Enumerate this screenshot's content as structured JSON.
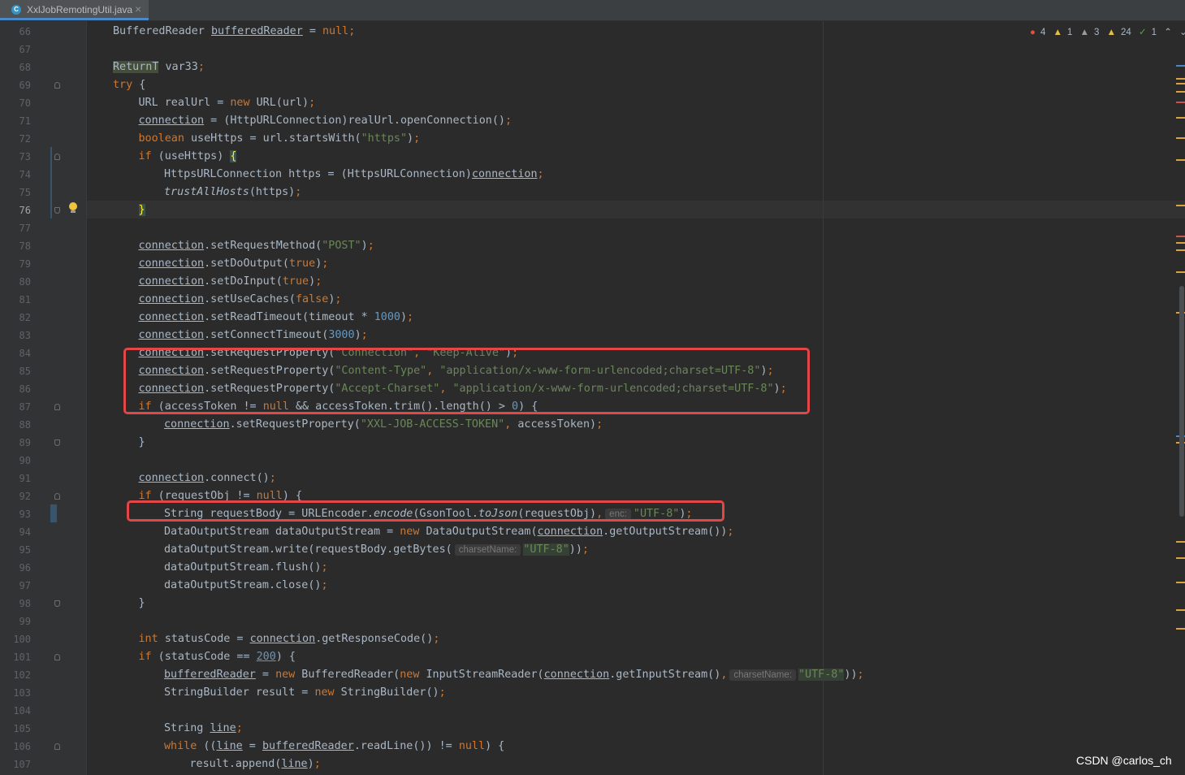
{
  "tab": {
    "icon": "class-icon",
    "label": "XxlJobRemotingUtil.java",
    "close": "×"
  },
  "inspections": {
    "errors": "4",
    "warnings": "1",
    "weak_warnings": "3",
    "typos": "24",
    "ok": "1",
    "up": "⌃",
    "down": "⌄"
  },
  "current_line": "76",
  "watermark": "CSDN @carlos_ch",
  "colors": {
    "keyword": "#cc7832",
    "string": "#6a8759",
    "number": "#6897bb",
    "highlight_box": "#e34646"
  },
  "lines": [
    {
      "n": "66",
      "indent": 0,
      "segs": [
        [
          "BufferedReader ",
          ""
        ],
        [
          "bufferedReader",
          "ul"
        ],
        [
          " = ",
          ""
        ],
        [
          "null",
          "kw"
        ],
        [
          ";",
          "kw"
        ]
      ]
    },
    {
      "n": "67",
      "indent": 0,
      "segs": []
    },
    {
      "n": "68",
      "indent": 0,
      "segs": [
        [
          "ReturnT",
          "hlret"
        ],
        [
          " var33",
          ""
        ],
        [
          ";",
          "kw"
        ]
      ]
    },
    {
      "n": "69",
      "indent": 0,
      "segs": [
        [
          "try",
          "kw"
        ],
        [
          " {",
          ""
        ]
      ]
    },
    {
      "n": "70",
      "indent": 1,
      "segs": [
        [
          "URL realUrl = ",
          ""
        ],
        [
          "new",
          "kw"
        ],
        [
          " URL(url)",
          ""
        ],
        [
          ";",
          "kw"
        ]
      ]
    },
    {
      "n": "71",
      "indent": 1,
      "segs": [
        [
          "connection",
          "ul"
        ],
        [
          " = (HttpURLConnection)realUrl.openConnection()",
          ""
        ],
        [
          ";",
          "kw"
        ]
      ]
    },
    {
      "n": "72",
      "indent": 1,
      "segs": [
        [
          "boolean",
          "kw"
        ],
        [
          " useHttps = url.startsWith(",
          ""
        ],
        [
          "\"https\"",
          "str"
        ],
        [
          ")",
          ""
        ],
        [
          ";",
          "kw"
        ]
      ]
    },
    {
      "n": "73",
      "indent": 1,
      "segs": [
        [
          "if",
          "kw"
        ],
        [
          " (useHttps) ",
          ""
        ],
        [
          "{",
          "brace"
        ]
      ]
    },
    {
      "n": "74",
      "indent": 2,
      "segs": [
        [
          "HttpsURLConnection https = (HttpsURLConnection)",
          ""
        ],
        [
          "connection",
          "ul"
        ],
        [
          ";",
          "kw"
        ]
      ]
    },
    {
      "n": "75",
      "indent": 2,
      "segs": [
        [
          "trustAllHosts",
          "it"
        ],
        [
          "(https)",
          ""
        ],
        [
          ";",
          "kw"
        ]
      ]
    },
    {
      "n": "76",
      "indent": 1,
      "segs": [
        [
          "}",
          "brace"
        ]
      ]
    },
    {
      "n": "77",
      "indent": 0,
      "segs": []
    },
    {
      "n": "78",
      "indent": 1,
      "segs": [
        [
          "connection",
          "ul"
        ],
        [
          ".setRequestMethod(",
          ""
        ],
        [
          "\"POST\"",
          "str"
        ],
        [
          ")",
          ""
        ],
        [
          ";",
          "kw"
        ]
      ]
    },
    {
      "n": "79",
      "indent": 1,
      "segs": [
        [
          "connection",
          "ul"
        ],
        [
          ".setDoOutput(",
          ""
        ],
        [
          "true",
          "kw"
        ],
        [
          ")",
          ""
        ],
        [
          ";",
          "kw"
        ]
      ]
    },
    {
      "n": "80",
      "indent": 1,
      "segs": [
        [
          "connection",
          "ul"
        ],
        [
          ".setDoInput(",
          ""
        ],
        [
          "true",
          "kw"
        ],
        [
          ")",
          ""
        ],
        [
          ";",
          "kw"
        ]
      ]
    },
    {
      "n": "81",
      "indent": 1,
      "segs": [
        [
          "connection",
          "ul"
        ],
        [
          ".setUseCaches(",
          ""
        ],
        [
          "false",
          "kw"
        ],
        [
          ")",
          ""
        ],
        [
          ";",
          "kw"
        ]
      ]
    },
    {
      "n": "82",
      "indent": 1,
      "segs": [
        [
          "connection",
          "ul"
        ],
        [
          ".setReadTimeout(timeout * ",
          ""
        ],
        [
          "1000",
          "num"
        ],
        [
          ")",
          ""
        ],
        [
          ";",
          "kw"
        ]
      ]
    },
    {
      "n": "83",
      "indent": 1,
      "segs": [
        [
          "connection",
          "ul"
        ],
        [
          ".setConnectTimeout(",
          ""
        ],
        [
          "3000",
          "num"
        ],
        [
          ")",
          ""
        ],
        [
          ";",
          "kw"
        ]
      ]
    },
    {
      "n": "84",
      "indent": 1,
      "segs": [
        [
          "connection",
          "ul"
        ],
        [
          ".setRequestProperty(",
          ""
        ],
        [
          "\"Connection\"",
          "str"
        ],
        [
          ", ",
          "kw"
        ],
        [
          "\"Keep-Alive\"",
          "str"
        ],
        [
          ")",
          ""
        ],
        [
          ";",
          "kw"
        ]
      ]
    },
    {
      "n": "85",
      "indent": 1,
      "segs": [
        [
          "connection",
          "ul"
        ],
        [
          ".setRequestProperty(",
          ""
        ],
        [
          "\"Content-Type\"",
          "str"
        ],
        [
          ", ",
          "kw"
        ],
        [
          "\"application/x-www-form-urlencoded;charset=UTF-8\"",
          "str"
        ],
        [
          ")",
          ""
        ],
        [
          ";",
          "kw"
        ]
      ]
    },
    {
      "n": "86",
      "indent": 1,
      "segs": [
        [
          "connection",
          "ul"
        ],
        [
          ".setRequestProperty(",
          ""
        ],
        [
          "\"Accept-Charset\"",
          "str"
        ],
        [
          ", ",
          "kw"
        ],
        [
          "\"application/x-www-form-urlencoded;charset=UTF-8\"",
          "str"
        ],
        [
          ")",
          ""
        ],
        [
          ";",
          "kw"
        ]
      ]
    },
    {
      "n": "87",
      "indent": 1,
      "segs": [
        [
          "if",
          "kw"
        ],
        [
          " (accessToken != ",
          ""
        ],
        [
          "null",
          "kw"
        ],
        [
          " && accessToken.trim().length() > ",
          ""
        ],
        [
          "0",
          "num"
        ],
        [
          ") {",
          ""
        ]
      ]
    },
    {
      "n": "88",
      "indent": 2,
      "segs": [
        [
          "connection",
          "ul"
        ],
        [
          ".setRequestProperty(",
          ""
        ],
        [
          "\"XXL-JOB-ACCESS-TOKEN\"",
          "str"
        ],
        [
          ", ",
          "kw"
        ],
        [
          "accessToken)",
          ""
        ],
        [
          ";",
          "kw"
        ]
      ]
    },
    {
      "n": "89",
      "indent": 1,
      "segs": [
        [
          "}",
          ""
        ]
      ]
    },
    {
      "n": "90",
      "indent": 0,
      "segs": []
    },
    {
      "n": "91",
      "indent": 1,
      "segs": [
        [
          "connection",
          "ul"
        ],
        [
          ".connect()",
          ""
        ],
        [
          ";",
          "kw"
        ]
      ]
    },
    {
      "n": "92",
      "indent": 1,
      "segs": [
        [
          "if",
          "kw"
        ],
        [
          " (requestObj != ",
          ""
        ],
        [
          "null",
          "kw"
        ],
        [
          ") {",
          ""
        ]
      ]
    },
    {
      "n": "93",
      "indent": 2,
      "segs": [
        [
          "String requestBody = URLEncoder.",
          ""
        ],
        [
          "encode",
          "it"
        ],
        [
          "(GsonTool.",
          ""
        ],
        [
          "toJson",
          "it"
        ],
        [
          "(requestObj)",
          ""
        ],
        [
          ",",
          "kw"
        ],
        [
          "enc:",
          "hint"
        ],
        [
          "\"UTF-8\"",
          "str"
        ],
        [
          ")",
          ""
        ],
        [
          ";",
          "kw"
        ]
      ]
    },
    {
      "n": "94",
      "indent": 2,
      "segs": [
        [
          "DataOutputStream dataOutputStream = ",
          ""
        ],
        [
          "new",
          "kw"
        ],
        [
          " DataOutputStream(",
          ""
        ],
        [
          "connection",
          "ul"
        ],
        [
          ".getOutputStream())",
          ""
        ],
        [
          ";",
          "kw"
        ]
      ]
    },
    {
      "n": "95",
      "indent": 2,
      "segs": [
        [
          "dataOutputStream.write(requestBody.getBytes(",
          ""
        ],
        [
          "charsetName:",
          "hint"
        ],
        [
          "\"UTF-8\"",
          "str hl"
        ],
        [
          "))",
          ""
        ],
        [
          ";",
          "kw"
        ]
      ]
    },
    {
      "n": "96",
      "indent": 2,
      "segs": [
        [
          "dataOutputStream.flush()",
          ""
        ],
        [
          ";",
          "kw"
        ]
      ]
    },
    {
      "n": "97",
      "indent": 2,
      "segs": [
        [
          "dataOutputStream.close()",
          ""
        ],
        [
          ";",
          "kw"
        ]
      ]
    },
    {
      "n": "98",
      "indent": 1,
      "segs": [
        [
          "}",
          ""
        ]
      ]
    },
    {
      "n": "99",
      "indent": 0,
      "segs": []
    },
    {
      "n": "100",
      "indent": 1,
      "segs": [
        [
          "int",
          "kw"
        ],
        [
          " statusCode = ",
          ""
        ],
        [
          "connection",
          "ul"
        ],
        [
          ".getResponseCode()",
          ""
        ],
        [
          ";",
          "kw"
        ]
      ]
    },
    {
      "n": "101",
      "indent": 1,
      "segs": [
        [
          "if",
          "kw"
        ],
        [
          " (statusCode == ",
          ""
        ],
        [
          "200",
          "num ul"
        ],
        [
          ") {",
          ""
        ]
      ]
    },
    {
      "n": "102",
      "indent": 2,
      "segs": [
        [
          "bufferedReader",
          "ul"
        ],
        [
          " = ",
          ""
        ],
        [
          "new",
          "kw"
        ],
        [
          " BufferedReader(",
          ""
        ],
        [
          "new",
          "kw"
        ],
        [
          " InputStreamReader(",
          ""
        ],
        [
          "connection",
          "ul"
        ],
        [
          ".getInputStream()",
          ""
        ],
        [
          ",",
          "kw"
        ],
        [
          "charsetName:",
          "hint"
        ],
        [
          "\"UTF-8\"",
          "str hl"
        ],
        [
          "))",
          ""
        ],
        [
          ";",
          "kw"
        ]
      ]
    },
    {
      "n": "103",
      "indent": 2,
      "segs": [
        [
          "StringBuilder result = ",
          ""
        ],
        [
          "new",
          "kw"
        ],
        [
          " StringBuilder()",
          ""
        ],
        [
          ";",
          "kw"
        ]
      ]
    },
    {
      "n": "104",
      "indent": 0,
      "segs": []
    },
    {
      "n": "105",
      "indent": 2,
      "segs": [
        [
          "String ",
          ""
        ],
        [
          "line",
          "ul"
        ],
        [
          ";",
          "kw"
        ]
      ]
    },
    {
      "n": "106",
      "indent": 2,
      "segs": [
        [
          "while",
          "kw"
        ],
        [
          " ((",
          ""
        ],
        [
          "line",
          "ul"
        ],
        [
          " = ",
          ""
        ],
        [
          "bufferedReader",
          "ul"
        ],
        [
          ".readLine()) != ",
          ""
        ],
        [
          "null",
          "kw"
        ],
        [
          ") {",
          ""
        ]
      ]
    },
    {
      "n": "107",
      "indent": 3,
      "segs": [
        [
          "result.append(",
          ""
        ],
        [
          "line",
          "ul"
        ],
        [
          ")",
          ""
        ],
        [
          ";",
          "kw"
        ]
      ]
    }
  ]
}
